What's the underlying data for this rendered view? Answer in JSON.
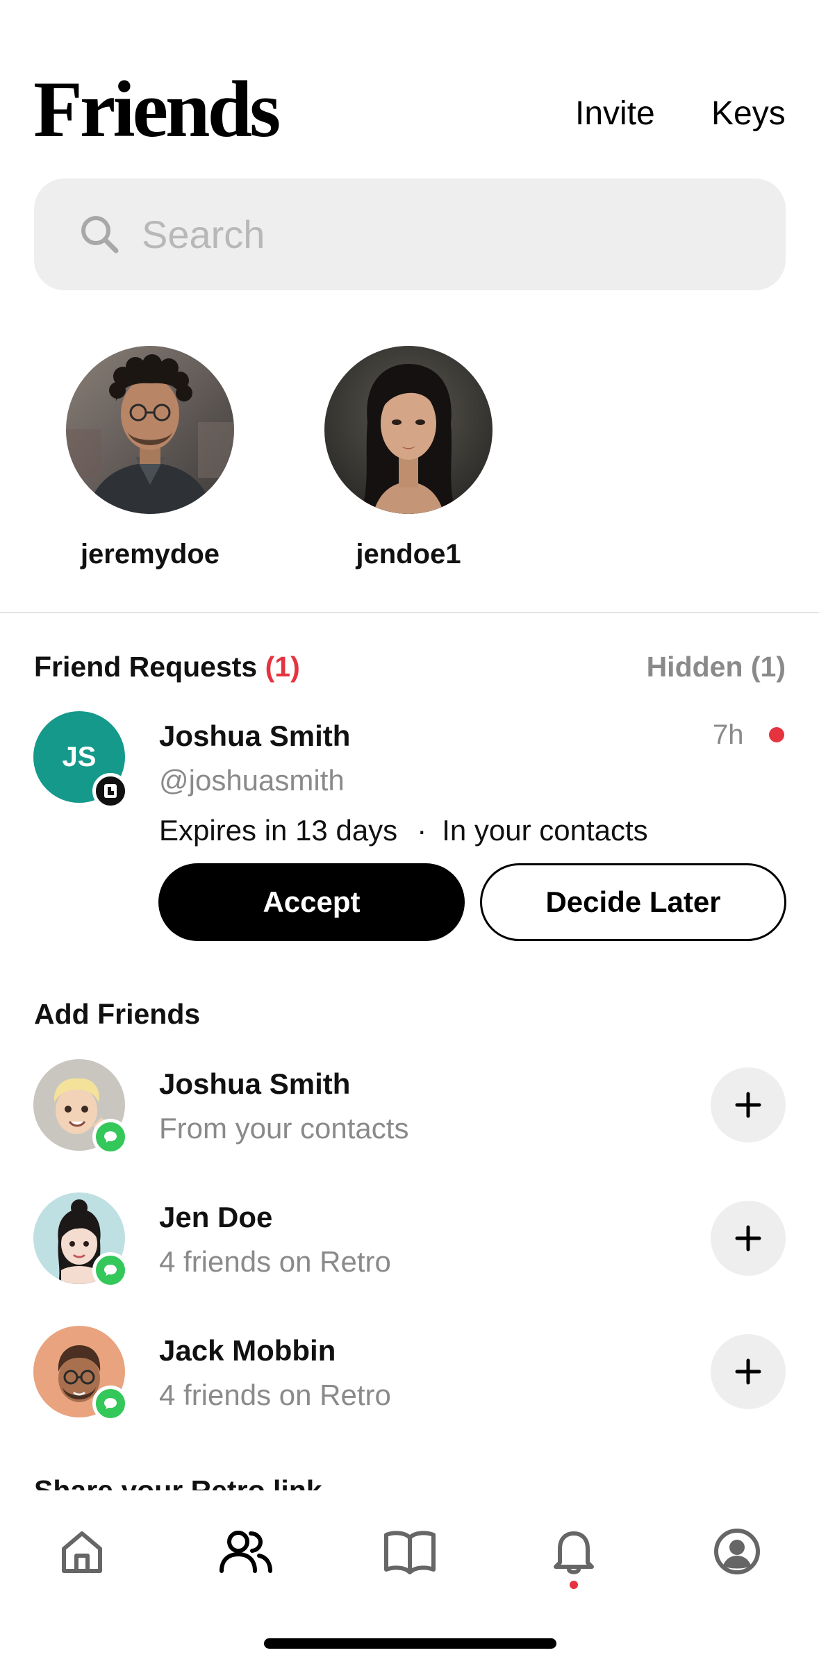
{
  "header": {
    "title": "Friends",
    "invite_label": "Invite",
    "keys_label": "Keys"
  },
  "search": {
    "placeholder": "Search",
    "icon": "search-icon"
  },
  "stories": [
    {
      "username": "jeremydoe"
    },
    {
      "username": "jendoe1"
    }
  ],
  "friend_requests": {
    "title": "Friend Requests",
    "count": "(1)",
    "hidden_label": "Hidden (1)",
    "request": {
      "initials": "JS",
      "name": "Joshua Smith",
      "handle": "@joshuasmith",
      "time": "7h",
      "expires": "Expires in 13 days",
      "separator": "·",
      "context": "In your contacts",
      "accept_label": "Accept",
      "later_label": "Decide Later"
    }
  },
  "add_friends": {
    "title": "Add Friends",
    "items": [
      {
        "name": "Joshua Smith",
        "subtitle": "From your contacts"
      },
      {
        "name": "Jen Doe",
        "subtitle": "4 friends on Retro"
      },
      {
        "name": "Jack Mobbin",
        "subtitle": "4 friends on Retro"
      }
    ]
  },
  "share_section": {
    "title": "Share your Retro link"
  },
  "tabbar": {
    "tabs": [
      "home-icon",
      "friends-icon",
      "book-icon",
      "bell-icon",
      "profile-icon"
    ],
    "active": "friends-icon"
  },
  "colors": {
    "accent_red": "#e5343f",
    "avatar_teal": "#14998a",
    "message_green": "#34c759",
    "muted_text": "#8a8a8a"
  }
}
